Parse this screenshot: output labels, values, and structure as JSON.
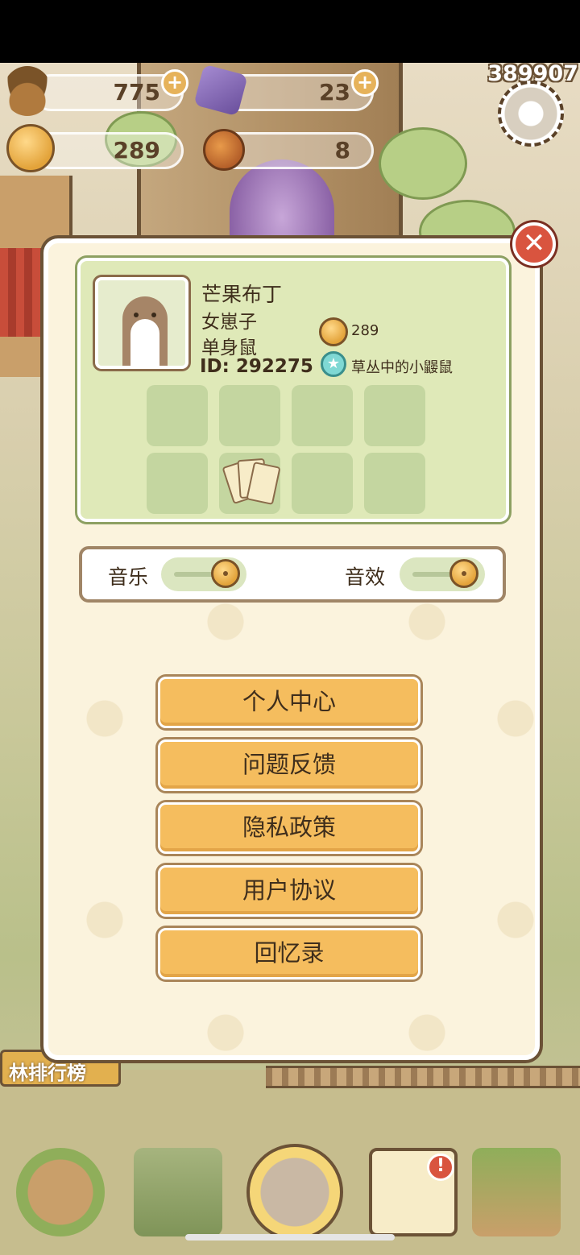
{
  "top_counter": "389907",
  "resources": {
    "acorn": {
      "value": "775",
      "icon": "acorn-icon"
    },
    "gem": {
      "value": "23",
      "icon": "gem-icon"
    },
    "bell": {
      "value": "289",
      "icon": "bell-icon"
    },
    "fruit": {
      "value": "8",
      "icon": "fruit-icon"
    },
    "plus_label": "+"
  },
  "background": {
    "sign_text": "林排行榜"
  },
  "profile": {
    "name": "芒果布丁",
    "gender": "女崽子",
    "status": "单身鼠",
    "id_text": "ID: 292275",
    "bells": "289",
    "badge_title": "草丛中的小鼹鼠",
    "badge_glyph": "★"
  },
  "settings": {
    "music_label": "音乐",
    "sfx_label": "音效"
  },
  "menu": {
    "personal_center": "个人中心",
    "feedback": "问题反馈",
    "privacy": "隐私政策",
    "user_agreement": "用户协议",
    "memories": "回忆录"
  },
  "close_glyph": "✕",
  "nav": {
    "notify_glyph": "!"
  },
  "colors": {
    "menu_button": "#f5bd5e",
    "profile_card": "#dfe9b8",
    "close_button": "#d9543f",
    "modal_bg": "#fbf3dd"
  }
}
